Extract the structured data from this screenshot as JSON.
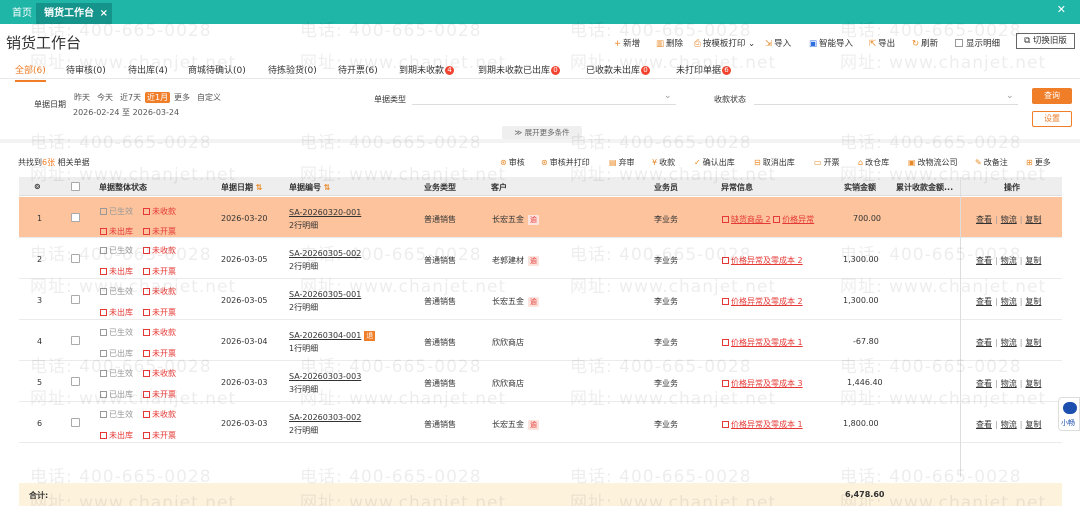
{
  "tabs": {
    "home": "首页",
    "active": "销货工作台",
    "close": "×",
    "more": "✕"
  },
  "page_title": "销货工作台",
  "toolbar": {
    "add": "新增",
    "delete": "删除",
    "print": "按模板打印",
    "import": "导入",
    "smart_import": "智能导入",
    "export": "导出",
    "refresh": "刷新",
    "show_detail": "显示明细",
    "switch_old": "切换旧版"
  },
  "status_tabs": [
    {
      "label": "全部(6)",
      "badge": ""
    },
    {
      "label": "待审核(0)",
      "badge": ""
    },
    {
      "label": "待出库(4)",
      "badge": ""
    },
    {
      "label": "商城待确认(0)",
      "badge": ""
    },
    {
      "label": "待拣验货(0)",
      "badge": ""
    },
    {
      "label": "待开票(6)",
      "badge": ""
    },
    {
      "label": "到期未收款",
      "badge": "4"
    },
    {
      "label": "到期未收款已出库",
      "badge": "0"
    },
    {
      "label": "已收款未出库",
      "badge": "0"
    },
    {
      "label": "未打印单据",
      "badge": "6"
    }
  ],
  "filters": {
    "date_label": "单据日期",
    "quick_dates": [
      "昨天",
      "今天",
      "近7天",
      "近1月",
      "更多",
      "自定义"
    ],
    "date_range": "2026-02-24 至 2026-03-24",
    "type_label": "单据类型",
    "pay_label": "收款状态",
    "query": "查询",
    "setting": "设置",
    "expand": "展开更多条件"
  },
  "result": {
    "prefix": "共找到",
    "count": "6张",
    "suffix": "相关单据"
  },
  "actions": [
    "审核",
    "审核并打印",
    "弃审",
    "收款",
    "确认出库",
    "取消出库",
    "开票",
    "改仓库",
    "改物流公司",
    "改备注",
    "更多"
  ],
  "table": {
    "headers": {
      "status": "单据整体状态",
      "date": "单据日期",
      "code": "单据编号",
      "biz": "业务类型",
      "customer": "客户",
      "sales": "业务员",
      "exception": "异常信息",
      "amount": "实销金额",
      "cumulative": "累计收款金额...",
      "ops": "操作"
    },
    "rows": [
      {
        "no": "1",
        "s1": "已生效",
        "s2": "未收款",
        "s3": "未出库",
        "s4": "未开票",
        "date": "2026-03-20",
        "code": "SA-20260320-001",
        "lines": "2行明细",
        "code_tag": "",
        "biz": "普通销售",
        "customer": "长宏五金",
        "cust_tag": "逾",
        "sales": "李业务",
        "exception": "缺货商品 2",
        "exception2": "价格异常",
        "amount": "700.00"
      },
      {
        "no": "2",
        "s1": "已生效",
        "s2": "未收款",
        "s3": "未出库",
        "s4": "未开票",
        "date": "2026-03-05",
        "code": "SA-20260305-002",
        "lines": "2行明细",
        "code_tag": "",
        "biz": "普通销售",
        "customer": "老郭建材",
        "cust_tag": "逾",
        "sales": "李业务",
        "exception": "价格异常及零成本 2",
        "exception2": "",
        "amount": "1,300.00"
      },
      {
        "no": "3",
        "s1": "已生效",
        "s2": "未收款",
        "s3": "未出库",
        "s4": "未开票",
        "date": "2026-03-05",
        "code": "SA-20260305-001",
        "lines": "2行明细",
        "code_tag": "",
        "biz": "普通销售",
        "customer": "长宏五金",
        "cust_tag": "逾",
        "sales": "李业务",
        "exception": "价格异常及零成本 2",
        "exception2": "",
        "amount": "1,300.00"
      },
      {
        "no": "4",
        "s1": "已生效",
        "s2": "未收款",
        "s3": "已出库",
        "s4": "未开票",
        "date": "2026-03-04",
        "code": "SA-20260304-001",
        "lines": "1行明细",
        "code_tag": "退",
        "biz": "普通销售",
        "customer": "欣欣商店",
        "cust_tag": "",
        "sales": "李业务",
        "exception": "价格异常及零成本 1",
        "exception2": "",
        "amount": "-67.80"
      },
      {
        "no": "5",
        "s1": "已生效",
        "s2": "未收款",
        "s3": "已出库",
        "s4": "未开票",
        "date": "2026-03-03",
        "code": "SA-20260303-003",
        "lines": "3行明细",
        "code_tag": "",
        "biz": "普通销售",
        "customer": "欣欣商店",
        "cust_tag": "",
        "sales": "李业务",
        "exception": "价格异常及零成本 3",
        "exception2": "",
        "amount": "1,446.40"
      },
      {
        "no": "6",
        "s1": "已生效",
        "s2": "未收款",
        "s3": "未出库",
        "s4": "未开票",
        "date": "2026-03-03",
        "code": "SA-20260303-002",
        "lines": "2行明细",
        "code_tag": "",
        "biz": "普通销售",
        "customer": "长宏五金",
        "cust_tag": "逾",
        "sales": "李业务",
        "exception": "价格异常及零成本 1",
        "exception2": "",
        "amount": "1,800.00"
      }
    ],
    "ops": {
      "view": "查看",
      "logistics": "物流",
      "copy": "复制"
    },
    "total_label": "合计:",
    "total_amount": "6,478.60"
  },
  "side_widget": "小畅",
  "watermark": {
    "phone": "电话: 400-665-0028",
    "site": "网址: www.chanjet.net"
  },
  "colors": {
    "accent": "#f07d27",
    "topbar": "#1fb5a7",
    "selected_row": "#fcc39c",
    "danger": "#e53935"
  }
}
